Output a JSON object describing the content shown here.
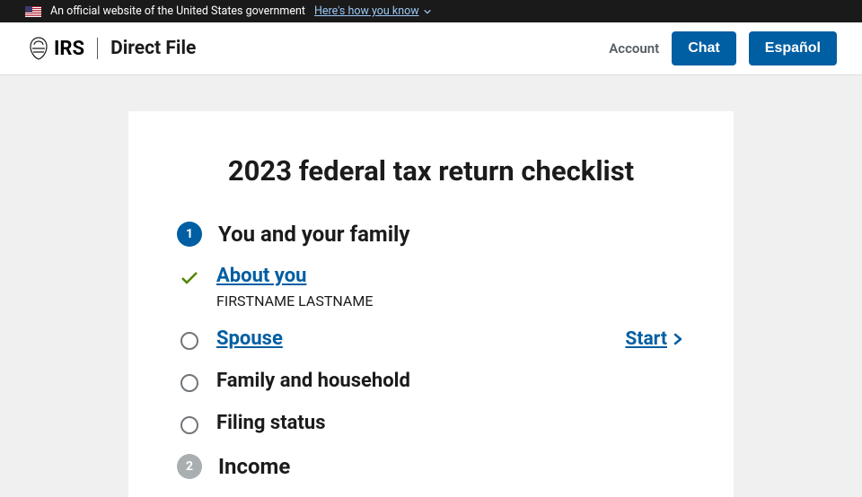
{
  "banner": {
    "text": "An official website of the United States government",
    "link": "Here's how you know"
  },
  "header": {
    "logo_text": "IRS",
    "product": "Direct File",
    "account": "Account",
    "chat": "Chat",
    "lang": "Español"
  },
  "page": {
    "title": "2023 federal tax return checklist"
  },
  "sections": [
    {
      "number": "1",
      "title": "You and your family",
      "active": true,
      "items": [
        {
          "label": "About you",
          "link": true,
          "status": "done",
          "sub": "FIRSTNAME LASTNAME"
        },
        {
          "label": "Spouse",
          "link": true,
          "status": "todo",
          "action": "Start"
        },
        {
          "label": "Family and household",
          "link": false,
          "status": "todo"
        },
        {
          "label": "Filing status",
          "link": false,
          "status": "todo"
        }
      ]
    },
    {
      "number": "2",
      "title": "Income",
      "active": false,
      "items": []
    }
  ]
}
